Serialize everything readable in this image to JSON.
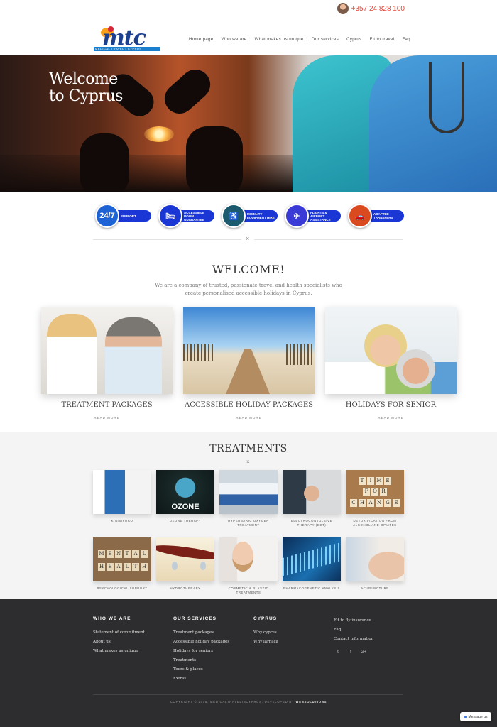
{
  "header": {
    "phone": "+357 24 828 100",
    "logo_text": "mtc",
    "logo_tagline": "MEDICAL TRAVEL • CYPRUS",
    "nav": [
      "Home page",
      "Who we are",
      "What makes us unique",
      "Our services",
      "Cyprus",
      "Fit to travel",
      "Faq"
    ]
  },
  "hero": {
    "title_line1": "Welcome",
    "title_line2": "to Cyprus"
  },
  "badges": [
    {
      "icon": "24-7-icon",
      "icon_text": "24/7",
      "label": "SUPPORT",
      "color": "#1e63d6"
    },
    {
      "icon": "bed-icon",
      "icon_text": "🛏",
      "label": "ACCESSIBLE ROOM GUARANTEE",
      "color": "#1a37d6"
    },
    {
      "icon": "wheelchair-icon",
      "icon_text": "♿",
      "label": "MOBILITY EQUIPMENT HIRE",
      "color": "#1b5a6f"
    },
    {
      "icon": "plane-icon",
      "icon_text": "✈",
      "label": "FLIGHTS & AIRPORT ASSISTANCE",
      "color": "#3a3ad6"
    },
    {
      "icon": "car-icon",
      "icon_text": "🚗",
      "label": "ADAPTED TRANSFERS",
      "color": "#d94a1f"
    }
  ],
  "welcome": {
    "title": "WELCOME!",
    "text": "We are a company of trusted, passionate travel and health specialists who create personalised accessible holidays in Cyprus."
  },
  "packages": [
    {
      "title": "TREATMENT PACKAGES",
      "more": "READ MORE"
    },
    {
      "title": "ACCESSIBLE HOLIDAY PACKAGES",
      "more": "READ MORE"
    },
    {
      "title": "HOLIDAYS FOR SENIOR",
      "more": "READ MORE"
    }
  ],
  "treatments": {
    "title": "TREATMENTS",
    "items": [
      "KINISIFORO",
      "OZONE THERAPY",
      "HYPERBARIC OXYGEN TREATMENT",
      "ELECTROCONVULSIVE THERAPY (ECT)",
      "DETOXIFICATION FROM ALCOHOL AND OPIATES",
      "PSYCHOLOGICAL SUPPORT",
      "HYDROTHERAPY",
      "COSMETIC & PLASTIC TREATMENTS",
      "PHARMACOGENETIC ANALYSIS",
      "ACUPUNCTURE"
    ],
    "ozone_label": "OZONE",
    "time_tiles": [
      "TIME",
      "FOR",
      "CHANGE"
    ],
    "mental_tiles": [
      "MENTAL",
      "HEALTH"
    ]
  },
  "footer": {
    "col1": {
      "title": "WHO WE ARE",
      "links": [
        "Statement of commitment",
        "About us",
        "What makes us unique"
      ]
    },
    "col2": {
      "title": "OUR SERVICES",
      "links": [
        "Treatment packages",
        "Accessible holiday packages",
        "Holidays for seniors",
        "Treatments",
        "Tours & places",
        "Extras"
      ]
    },
    "col3": {
      "title": "CYPRUS",
      "links": [
        "Why cyprus",
        "Why larnaca"
      ]
    },
    "col4": {
      "links": [
        "Fit to fly insurance",
        "Faq",
        "Contact information"
      ]
    },
    "social": [
      "twitter-icon",
      "facebook-icon",
      "google-plus-icon"
    ],
    "social_glyphs": [
      "t",
      "f",
      "G+"
    ],
    "copyright": "COPYRIGHT © 2018. MEDICALTRAVELINCYPRUS. DEVELOPED BY",
    "developer": "WEBSOLUTIONS"
  },
  "widget": {
    "label": "Message us"
  }
}
